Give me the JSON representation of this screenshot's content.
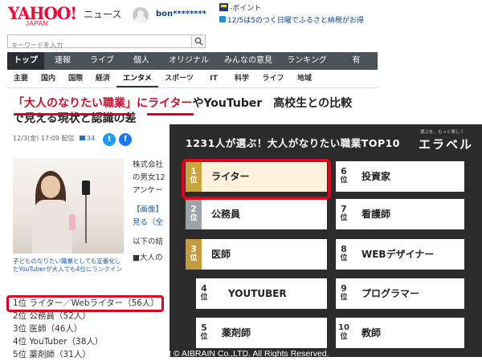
{
  "header": {
    "logo_main": "YAHOO!",
    "logo_sub": "JAPAN",
    "section_label": "ニュース",
    "username": "bon********",
    "tpoint_label": "-ポイント",
    "notice": "12/5は5のつく日曜でふるさと納税がお得"
  },
  "search": {
    "placeholder": "キーワードを入力"
  },
  "nav_primary": [
    {
      "label": "トップ",
      "active": true
    },
    {
      "label": "速報"
    },
    {
      "label": "ライブ"
    },
    {
      "label": "個人"
    },
    {
      "label": "オリジナル"
    },
    {
      "label": "みんなの意見"
    },
    {
      "label": "ランキング"
    },
    {
      "label": "有"
    }
  ],
  "nav_secondary": [
    {
      "label": "主要"
    },
    {
      "label": "国内"
    },
    {
      "label": "国際"
    },
    {
      "label": "経済"
    },
    {
      "label": "エンタメ",
      "active": true
    },
    {
      "label": "スポーツ"
    },
    {
      "label": "IT"
    },
    {
      "label": "科学"
    },
    {
      "label": "ライフ"
    },
    {
      "label": "地域"
    }
  ],
  "article": {
    "headline_part1": "「大人のなりたい職業」にライター",
    "headline_part2": "やYouTuber　高校生との比較",
    "headline_line2": "で見える現状と認識の差",
    "date": "12/3(金) 17:09 配信",
    "comment_count": "34",
    "twitter_glyph": "t",
    "facebook_glyph": "f",
    "photo_caption": "子どものなりたい職業としても定番化したYouTuberが大人でも4位にランクイン",
    "body_lines": [
      "株式会社",
      "の男女12",
      "アンケー"
    ],
    "link_lines": [
      "【画像】",
      "見る（全"
    ],
    "body_after": "以下の結",
    "bullet": "■大人の",
    "ranking": [
      "1位 ライター／Webライター（56人）",
      "2位 公務員（52人）",
      "3位 医師（46人）",
      "4位 YouTuber（38人）",
      "5位 薬剤師（31人）"
    ]
  },
  "overlay": {
    "title": "1231人が選ぶ！大人がなりたい職業TOP10",
    "brand_sub": "選ぶを、もっと楽しく",
    "brand": "エラベル",
    "rank_suffix": "位",
    "left_items": [
      {
        "rank": "1",
        "label": "ライター"
      },
      {
        "rank": "2",
        "label": "公務員"
      },
      {
        "rank": "3",
        "label": "医師"
      },
      {
        "rank": "4",
        "label": "YOUTUBER"
      },
      {
        "rank": "5",
        "label": "薬剤師"
      }
    ],
    "right_items": [
      {
        "rank": "6",
        "label": "投資家"
      },
      {
        "rank": "7",
        "label": "看護師"
      },
      {
        "rank": "8",
        "label": "WEBデザイナー"
      },
      {
        "rank": "9",
        "label": "プログラマー"
      },
      {
        "rank": "10",
        "label": "教師"
      }
    ],
    "colors": {
      "gold": "#c9a53c",
      "silver": "#9ea3a8",
      "bronze": "#c69a3a",
      "highlight": "#e0001e"
    }
  },
  "footer": {
    "copyright": "Copyright © AIBRAIN Co.,LTD. All Rights Reserved."
  }
}
